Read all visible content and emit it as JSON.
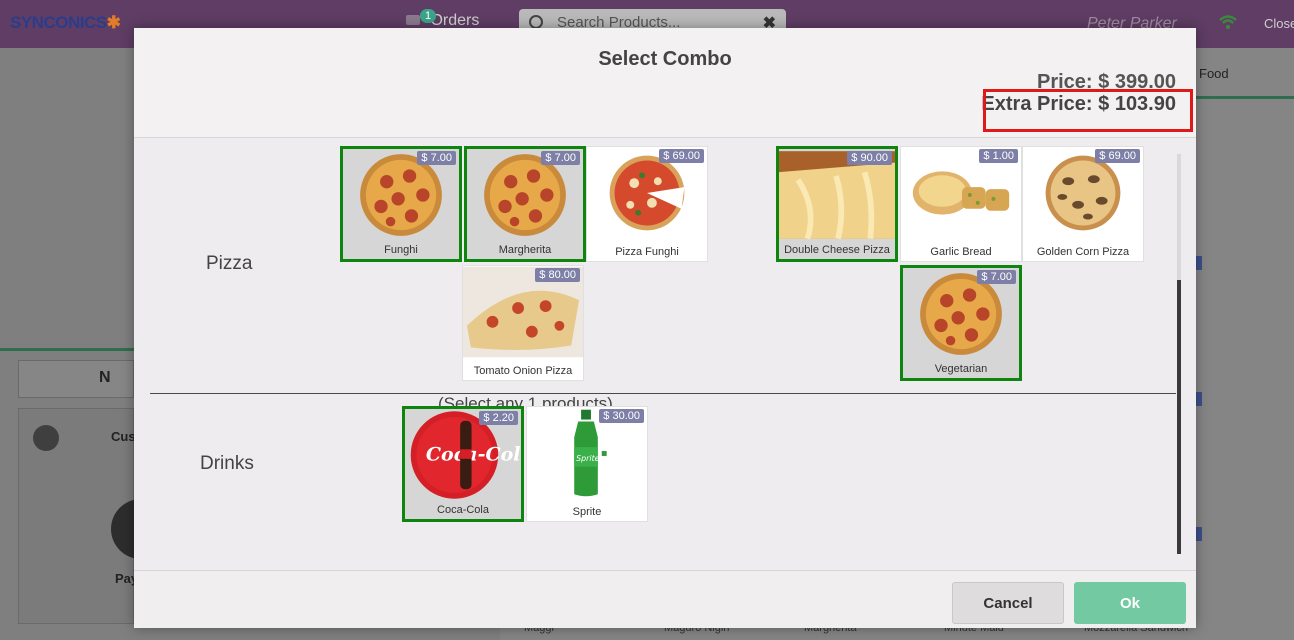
{
  "app": {
    "logo": "SYNCONICS",
    "orders_label": "Orders",
    "orders_count": "1",
    "search_placeholder": "Search Products...",
    "user": "Peter Parker",
    "close_label": "Close",
    "category_tab": "Food",
    "note_label": "N",
    "customer_label": "Cus",
    "payment_label": "Pay",
    "bottom_products": [
      "Maggi",
      "Maguro Nigiri",
      "Margherita",
      "Minute Maid",
      "Mozzarella Sandwich"
    ]
  },
  "modal": {
    "title": "Select Combo",
    "price": "Price: $ 399.00",
    "extra_price": "Extra Price: $ 103.90",
    "groups": [
      {
        "label": "Pizza",
        "products": [
          {
            "name": "Funghi",
            "price": "$ 7.00",
            "selected": true,
            "image": "pepperoni-pizza"
          },
          {
            "name": "Margherita",
            "price": "$ 7.00",
            "selected": true,
            "image": "pepperoni-pizza"
          },
          {
            "name": "Pizza Funghi",
            "price": "$ 69.00",
            "selected": false,
            "image": "tomato-pizza"
          },
          {
            "name": "Tomato Onion Pizza",
            "price": "$ 80.00",
            "selected": false,
            "image": "cheese-slice-pizza"
          },
          {
            "name": "Double Cheese Pizza",
            "price": "$ 90.00",
            "selected": true,
            "image": "cheese-pull-pizza"
          },
          {
            "name": "Garlic Bread",
            "price": "$ 1.00",
            "selected": false,
            "image": "garlic-bread"
          },
          {
            "name": "Golden Corn Pizza",
            "price": "$ 69.00",
            "selected": false,
            "image": "mushroom-pizza"
          },
          {
            "name": "Vegetarian",
            "price": "$ 7.00",
            "selected": true,
            "image": "pepperoni-pizza"
          }
        ]
      },
      {
        "label": "Drinks",
        "note": "(Select any 1 products)",
        "products": [
          {
            "name": "Coca-Cola",
            "price": "$ 2.20",
            "selected": true,
            "image": "coca-cola"
          },
          {
            "name": "Sprite",
            "price": "$ 30.00",
            "selected": false,
            "image": "sprite-bottle"
          }
        ]
      }
    ],
    "cancel_label": "Cancel",
    "ok_label": "Ok"
  },
  "colors": {
    "selected_border": "#0e850e",
    "highlight_box": "#e11818",
    "price_badge": "#7d7fa6",
    "ok_button": "#73c9a1"
  }
}
